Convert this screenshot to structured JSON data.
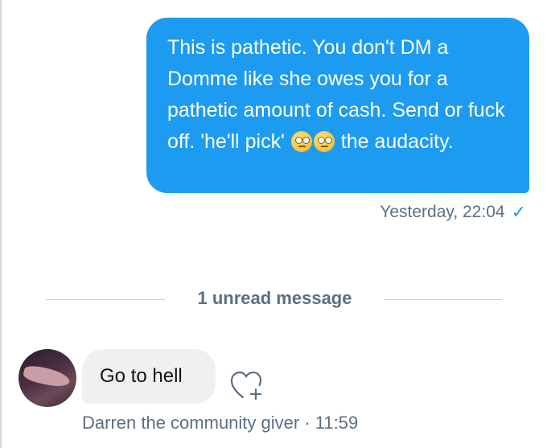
{
  "conversation": {
    "sent_message": {
      "text_part1": "This is pathetic. You don't DM a Domme like she owes you for a pathetic amount of cash. Send or fuck off. 'he'll pick' ",
      "emojis": [
        "face-with-rolling-eyes",
        "face-with-rolling-eyes"
      ],
      "text_part2": " the audacity.",
      "timestamp": "Yesterday, 22:04",
      "status_icon": "check-icon",
      "bubble_color": "#1d9bf0"
    },
    "unread_divider": {
      "label": "1 unread message"
    },
    "received_message": {
      "text": "Go to hell",
      "sender": "Darren the community giver",
      "separator": "·",
      "time": "11:59",
      "bubble_color": "#eef0f2",
      "react_icon": "add-reaction-heart-icon"
    }
  }
}
